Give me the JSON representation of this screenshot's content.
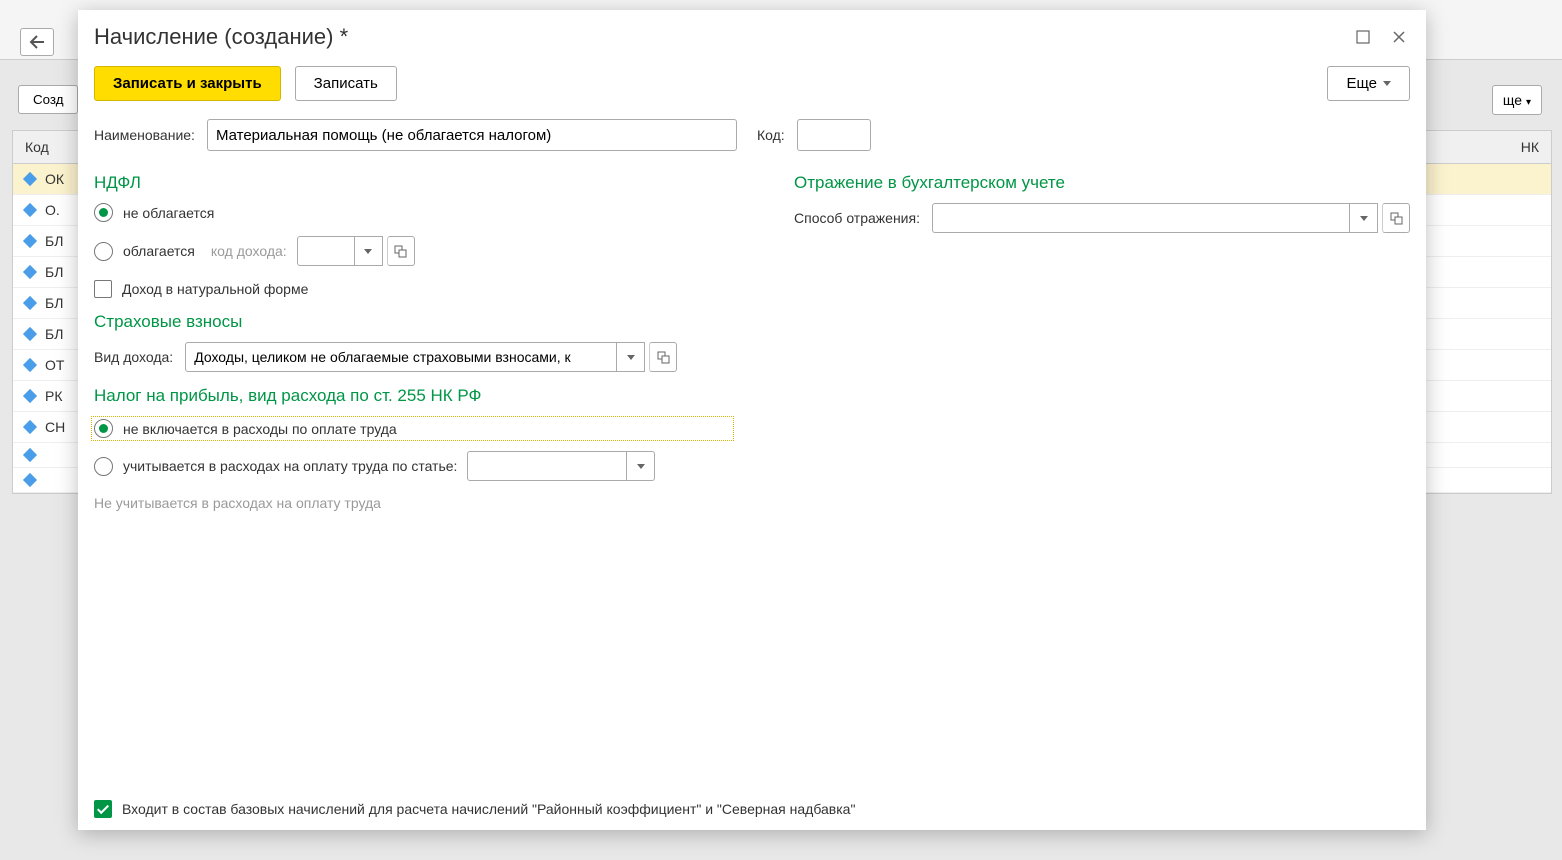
{
  "bg": {
    "create_label": "Созд",
    "more_label": "ще",
    "header_code": "Код",
    "header_nk": "НК",
    "rows": [
      "ОК",
      "О.",
      "БЛ",
      "БЛ",
      "БЛ",
      "БЛ",
      "ОТ",
      "РК",
      "СН",
      "",
      ""
    ]
  },
  "dialog": {
    "title": "Начисление (создание) *",
    "save_close": "Записать и закрыть",
    "save": "Записать",
    "more": "Еще",
    "name_label": "Наименование:",
    "name_value": "Материальная помощь (не облагается налогом)",
    "code_label": "Код:",
    "code_value": "",
    "ndfl": {
      "title": "НДФЛ",
      "not_taxed": "не облагается",
      "taxed": "облагается",
      "income_code_label": "код дохода:",
      "natural_income": "Доход в натуральной форме"
    },
    "accounting": {
      "title": "Отражение в бухгалтерском учете",
      "method_label": "Способ отражения:",
      "method_value": ""
    },
    "insurance": {
      "title": "Страховые взносы",
      "income_type_label": "Вид дохода:",
      "income_type_value": "Доходы, целиком не облагаемые страховыми взносами, к"
    },
    "profit_tax": {
      "title": "Налог на прибыль, вид расхода по ст. 255 НК РФ",
      "not_included": "не включается в расходы по оплате труда",
      "by_article": "учитывается в расходах на оплату труда по статье:",
      "note": "Не учитывается в расходах на оплату труда"
    },
    "footer_check": "Входит в состав базовых начислений для расчета начислений \"Районный коэффициент\" и \"Северная надбавка\""
  }
}
